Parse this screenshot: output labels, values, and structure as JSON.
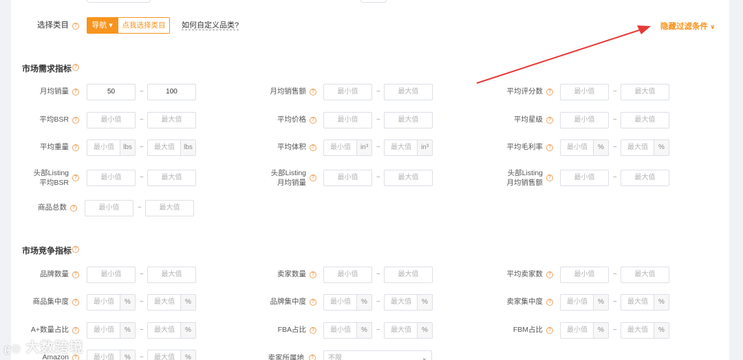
{
  "header": {
    "category_label": "选择类目",
    "nav_button": "导航",
    "choose_category_button": "点我选择类目",
    "custom_category_link": "如何自定义品类?",
    "hide_filter": "隐藏过滤条件"
  },
  "sections": {
    "demand": {
      "title": "市场需求指标"
    },
    "competition": {
      "title": "市场竞争指标"
    }
  },
  "placeholders": {
    "min": "最小值",
    "max": "最大值"
  },
  "fields": [
    {
      "id": "monthly-sales",
      "label": "月均销量",
      "min": "50",
      "max": "100"
    },
    {
      "id": "monthly-revenue",
      "label": "月均销售额",
      "min": "",
      "max": ""
    },
    {
      "id": "avg-reviews",
      "label": "平均评分数",
      "min": "",
      "max": ""
    },
    {
      "id": "avg-bsr",
      "label": "平均BSR",
      "min": "",
      "max": ""
    },
    {
      "id": "avg-price",
      "label": "平均价格",
      "min": "",
      "max": ""
    },
    {
      "id": "avg-rating",
      "label": "平均星级",
      "min": "",
      "max": ""
    },
    {
      "id": "avg-weight",
      "label": "平均重量",
      "min": "",
      "max": "",
      "unit": "lbs"
    },
    {
      "id": "avg-volume",
      "label": "平均体积",
      "min": "",
      "max": "",
      "unit": "in³"
    },
    {
      "id": "avg-margin",
      "label": "平均毛利率",
      "min": "",
      "max": "",
      "unit": "%"
    },
    {
      "id": "top-listing-bsr",
      "label_line1": "头部Listing",
      "label_line2": "平均BSR",
      "min": "",
      "max": ""
    },
    {
      "id": "top-listing-sales",
      "label_line1": "头部Listing",
      "label_line2": "月均销量",
      "min": "",
      "max": ""
    },
    {
      "id": "top-listing-revenue",
      "label_line1": "头部Listing",
      "label_line2": "月均销售额",
      "min": "",
      "max": ""
    },
    {
      "id": "total-products",
      "label": "商品总数",
      "min": "",
      "max": ""
    },
    {
      "id": "brand-count",
      "label": "品牌数量",
      "min": "",
      "max": ""
    },
    {
      "id": "seller-count",
      "label": "卖家数量",
      "min": "",
      "max": ""
    },
    {
      "id": "avg-seller-count",
      "label": "平均卖家数",
      "min": "",
      "max": ""
    },
    {
      "id": "product-concentration",
      "label": "商品集中度",
      "min": "",
      "max": "",
      "unit": "%"
    },
    {
      "id": "brand-concentration",
      "label": "品牌集中度",
      "min": "",
      "max": "",
      "unit": "%"
    },
    {
      "id": "seller-concentration",
      "label": "卖家集中度",
      "min": "",
      "max": "",
      "unit": "%"
    },
    {
      "id": "aplus-ratio",
      "label": "A+数量占比",
      "min": "",
      "max": "",
      "unit": "%"
    },
    {
      "id": "fba-ratio",
      "label": "FBA占比",
      "min": "",
      "max": "",
      "unit": "%"
    },
    {
      "id": "fbm-ratio",
      "label": "FBM占比",
      "min": "",
      "max": "",
      "unit": "%"
    },
    {
      "id": "amazon-ratio",
      "label": "Amazon",
      "min": "",
      "max": "",
      "unit": "%"
    },
    {
      "id": "seller-location",
      "label": "卖家所属地",
      "select_value": "不限"
    }
  ],
  "watermark": "大数跨境",
  "colors": {
    "accent": "#f7941d",
    "arrow": "#e53935"
  }
}
